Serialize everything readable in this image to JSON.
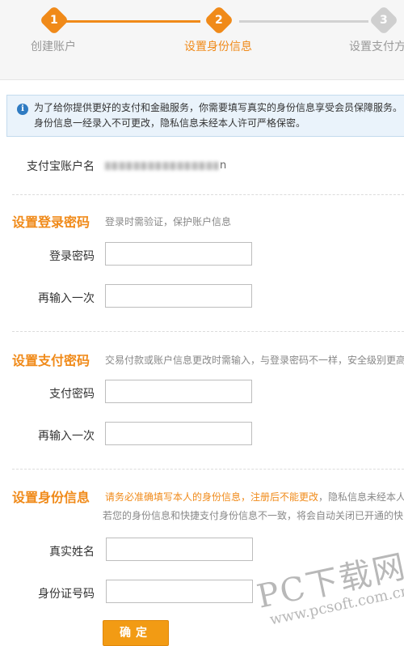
{
  "steps": [
    {
      "number": "1",
      "label": "创建账户"
    },
    {
      "number": "2",
      "label": "设置身份信息"
    },
    {
      "number": "3",
      "label": "设置支付方"
    }
  ],
  "notice": {
    "line1": "为了给你提供更好的支付和金融服务，你需要填写真实的身份信息享受会员保障服务。",
    "line2": "身份信息一经录入不可更改，隐私信息未经本人许可严格保密。"
  },
  "account": {
    "label": "支付宝账户名",
    "value_tail": "n"
  },
  "login_password": {
    "title": "设置登录密码",
    "desc": "登录时需验证，保护账户信息",
    "field1_label": "登录密码",
    "field2_label": "再输入一次"
  },
  "pay_password": {
    "title": "设置支付密码",
    "desc": "交易付款或账户信息更改时需输入，与登录密码不一样，安全级别更高",
    "field1_label": "支付密码",
    "field2_label": "再输入一次"
  },
  "identity": {
    "title": "设置身份信息",
    "desc_warn": "请务必准确填写本人的身份信息，注册后不能更改",
    "desc_rest": "，隐私信息未经本人",
    "desc_line2": "若您的身份信息和快捷支付身份信息不一致，将会自动关闭已开通的快",
    "field1_label": "真实姓名",
    "field2_label": "身份证号码"
  },
  "confirm_label": "确定",
  "watermark": {
    "main": "PC下载网",
    "sub": "www.pcsoft.com.cn"
  }
}
